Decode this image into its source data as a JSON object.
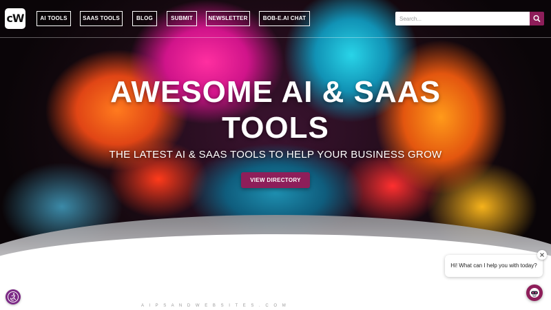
{
  "header": {
    "logo_text": "cW",
    "nav": {
      "ai_tools": "AI TOOLS",
      "saas_tools": "SAAS TOOLS",
      "blog": "BLOG",
      "submit": "SUBMIT",
      "newsletter": "NEWSLETTER",
      "bob_chat": "BOB-E.AI CHAT"
    },
    "search": {
      "placeholder": "Search...",
      "icon": "search-icon"
    }
  },
  "hero": {
    "title_line1": "AWESOME AI & SAAS",
    "title_line2": "TOOLS",
    "subtitle": "THE LATEST AI & SAAS TOOLS TO HELP YOUR BUSINESS GROW",
    "cta_label": "VIEW DIRECTORY"
  },
  "footer": {
    "site_text": "A I P S A N D W E B S I T E S . C O M"
  },
  "chat": {
    "greeting": "Hi! What can I help you with today?",
    "close_icon": "close-icon",
    "launcher_icon": "chatbot-icon"
  },
  "accessibility": {
    "icon": "accessibility-icon"
  },
  "colors": {
    "accent": "#8e1e5a",
    "accessibility_button": "#7c2a86",
    "nav_border": "#ffffff"
  }
}
